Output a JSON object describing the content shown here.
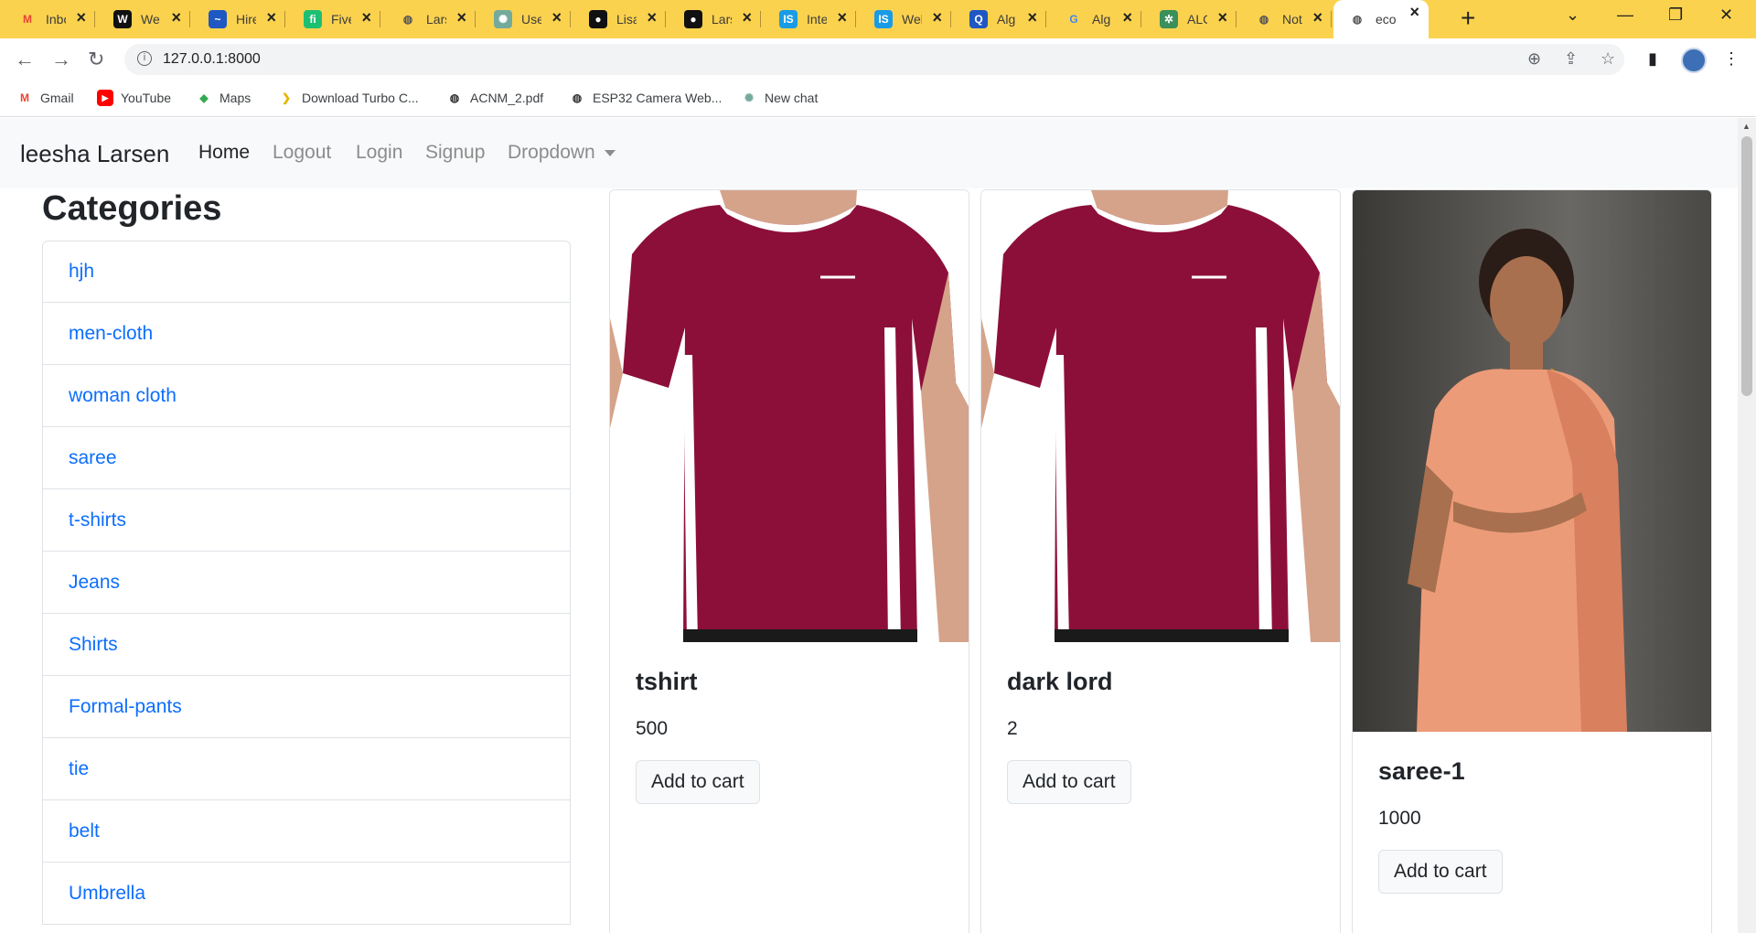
{
  "browser": {
    "tabs": [
      {
        "title": "Inbox",
        "icon": "gmail-icon",
        "color": "#ea4335",
        "glyph": "M"
      },
      {
        "title": "We",
        "icon": "wwf-icon",
        "color": "#111111",
        "glyph": "W"
      },
      {
        "title": "Hire",
        "icon": "upwork-icon",
        "color": "#1f57c3",
        "glyph": "~"
      },
      {
        "title": "Five",
        "icon": "fiverr-icon",
        "color": "#1dbf73",
        "glyph": "fi"
      },
      {
        "title": "Lars",
        "icon": "globe-icon",
        "color": "#555555",
        "glyph": "◍"
      },
      {
        "title": "Use",
        "icon": "chatgpt-icon",
        "color": "#74aa9c",
        "glyph": "✺"
      },
      {
        "title": "Lisa",
        "icon": "github-icon",
        "color": "#111111",
        "glyph": "●"
      },
      {
        "title": "Lars",
        "icon": "github-icon",
        "color": "#111111",
        "glyph": "●"
      },
      {
        "title": "Inte",
        "icon": "is-icon",
        "color": "#1a9be6",
        "glyph": "IS"
      },
      {
        "title": "Wel",
        "icon": "is-icon",
        "color": "#1a9be6",
        "glyph": "IS"
      },
      {
        "title": "Alg",
        "icon": "quora-icon",
        "color": "#1f57c3",
        "glyph": "Q"
      },
      {
        "title": "Alg",
        "icon": "google-icon",
        "color": "#4285f4",
        "glyph": "G"
      },
      {
        "title": "ALC",
        "icon": "tree-icon",
        "color": "#3a8f5a",
        "glyph": "✲"
      },
      {
        "title": "Not",
        "icon": "globe-icon",
        "color": "#555555",
        "glyph": "◍"
      },
      {
        "title": "eco",
        "icon": "globe-icon",
        "color": "#555555",
        "glyph": "◍",
        "active": true
      }
    ],
    "url": "127.0.0.1:8000",
    "bookmarks": [
      {
        "label": "Gmail",
        "icon": "gmail-icon"
      },
      {
        "label": "YouTube",
        "icon": "youtube-icon"
      },
      {
        "label": "Maps",
        "icon": "maps-icon"
      },
      {
        "label": "Download Turbo C...",
        "icon": "turbo-icon"
      },
      {
        "label": "ACNM_2.pdf",
        "icon": "globe-icon"
      },
      {
        "label": "ESP32 Camera Web...",
        "icon": "globe-icon"
      },
      {
        "label": "New chat",
        "icon": "chatgpt-icon"
      }
    ]
  },
  "navbar": {
    "brand": "leesha Larsen",
    "links": [
      "Home",
      "Logout",
      "Login",
      "Signup",
      "Dropdown"
    ]
  },
  "categories": {
    "title": "Categories",
    "items": [
      "hjh",
      "men-cloth",
      "woman cloth",
      "saree",
      "t-shirts",
      "Jeans",
      "Shirts",
      "Formal-pants",
      "tie",
      "belt",
      "Umbrella"
    ]
  },
  "products": [
    {
      "title": "tshirt",
      "price": "500",
      "button": "Add to cart",
      "image": "maroon-tshirt"
    },
    {
      "title": "dark lord",
      "price": "2",
      "button": "Add to cart",
      "image": "maroon-tshirt"
    },
    {
      "title": "saree-1",
      "price": "1000",
      "button": "Add to cart",
      "image": "woman-saree"
    }
  ],
  "colors": {
    "tabstrip": "#fbd24e",
    "link": "#0d6efd",
    "navbar_bg": "#f8f9fa"
  }
}
